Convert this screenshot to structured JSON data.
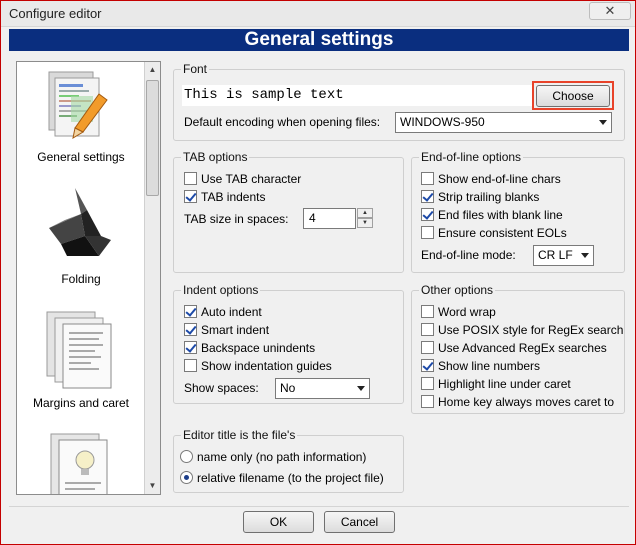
{
  "window": {
    "title": "Configure editor",
    "close_glyph": "✕"
  },
  "header": {
    "title": "General settings"
  },
  "left_list": {
    "items": [
      {
        "label": "General settings",
        "icon": "document-pencil-icon"
      },
      {
        "label": "Folding",
        "icon": "origami-bird-icon"
      },
      {
        "label": "Margins and caret",
        "icon": "pages-icon"
      },
      {
        "label": "",
        "icon": "lightbulb-document-icon"
      }
    ]
  },
  "font": {
    "group_label": "Font",
    "sample_text": "This is sample text",
    "choose_label": "Choose",
    "encoding_label": "Default encoding when opening files:",
    "encoding_value": "WINDOWS-950"
  },
  "tab_options": {
    "group_label": "TAB options",
    "use_tab": {
      "label": "Use TAB character",
      "checked": false
    },
    "tab_indents": {
      "label": "TAB indents",
      "checked": true
    },
    "tab_size_label": "TAB size in spaces:",
    "tab_size_value": "4"
  },
  "eol_options": {
    "group_label": "End-of-line options",
    "items": [
      {
        "label": "Show end-of-line chars",
        "checked": false
      },
      {
        "label": "Strip trailing blanks",
        "checked": true
      },
      {
        "label": "End files with blank line",
        "checked": true
      },
      {
        "label": "Ensure consistent EOLs",
        "checked": false
      }
    ],
    "mode_label": "End-of-line mode:",
    "mode_value": "CR LF"
  },
  "indent_options": {
    "group_label": "Indent options",
    "items": [
      {
        "label": "Auto indent",
        "checked": true
      },
      {
        "label": "Smart indent",
        "checked": true
      },
      {
        "label": "Backspace unindents",
        "checked": true
      },
      {
        "label": "Show indentation guides",
        "checked": false
      }
    ],
    "spaces_label": "Show spaces:",
    "spaces_value": "No"
  },
  "other_options": {
    "group_label": "Other options",
    "items": [
      {
        "label": "Word wrap",
        "checked": false
      },
      {
        "label": "Use POSIX style for RegEx search",
        "checked": false
      },
      {
        "label": "Use Advanced RegEx searches",
        "checked": false
      },
      {
        "label": "Show line numbers",
        "checked": true
      },
      {
        "label": "Highlight line under caret",
        "checked": false
      },
      {
        "label": "Home key always moves caret to",
        "checked": false
      }
    ]
  },
  "title_options": {
    "group_label": "Editor title is the file's",
    "items": [
      {
        "label": "name only (no path information)",
        "selected": false
      },
      {
        "label": "relative filename (to the project file)",
        "selected": true
      }
    ]
  },
  "footer": {
    "ok_label": "OK",
    "cancel_label": "Cancel"
  }
}
